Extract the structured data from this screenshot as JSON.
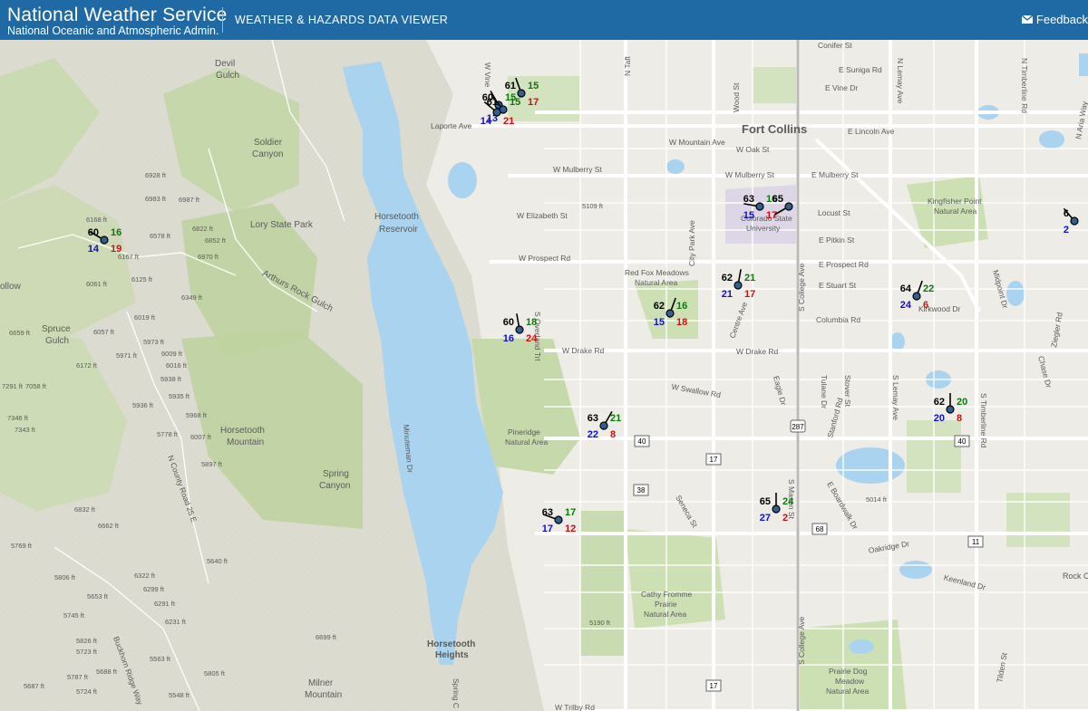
{
  "header": {
    "brand_title": "National Weather Service",
    "brand_subtitle": "National Oceanic and Atmospheric Admin.",
    "viewer_title": "WEATHER & HAZARDS DATA VIEWER",
    "feedback_label": "Feedback",
    "feedback_icon": "mail-icon"
  },
  "colors": {
    "header_bg": "#1f6aa5",
    "water": "#a9d3ee",
    "park_green": "#c8dcb3",
    "temperature": "#000000",
    "dewpoint": "#0a7a0a",
    "wind_speed": "#1010c8",
    "wind_gust": "#d01010",
    "station_marker": "#2f5f8f"
  },
  "map": {
    "place_labels": {
      "fort_collins": "Fort Collins",
      "horsetooth_reservoir": "Horsetooth Reservoir",
      "horsetooth_mountain": "Horsetooth Mountain",
      "horsetooth_heights": "Horsetooth Heights",
      "lory_state_park": "Lory State Park",
      "soldier_canyon": "Soldier Canyon",
      "devil_gulch": "Devil Gulch",
      "spruce_gulch": "Spruce Gulch",
      "spring_canyon": "Spring Canyon",
      "milner_mountain": "Milner Mountain",
      "arthurs_rock_gulch": "Arthurs Rock Gulch",
      "pineridge_natural_area": "Pineridge Natural Area",
      "red_fox_meadows": "Red Fox Meadows Natural Area",
      "colorado_state_university": "Colorado State University",
      "kingfisher_point": "Kingfisher Point Natural Area",
      "cathy_fromme": "Cathy Fromme Prairie Natural Area",
      "prairie_dog_meadow": "Prairie Dog Meadow Natural Area",
      "hollow_partial": "ollow",
      "rock_partial": "Rock C"
    },
    "street_labels": {
      "laporte_ave": "Laporte Ave",
      "w_mountain_ave": "W Mountain Ave",
      "w_oak_st": "W Oak St",
      "w_mulberry_st": "W Mulberry St",
      "w_mulberry_st_2": "W Mulberry St",
      "e_mulberry_st": "E Mulberry St",
      "w_elizabeth_st": "W Elizabeth St",
      "locust_st": "Locust St",
      "e_pitkin_st": "E Pitkin St",
      "w_prospect_rd": "W Prospect Rd",
      "e_prospect_rd": "E Prospect Rd",
      "e_stuart_st": "E Stuart St",
      "columbia_rd": "Columbia Rd",
      "kirkwood_dr": "Kirkwood Dr",
      "w_drake_rd": "W Drake Rd",
      "w_drake_rd_2": "W Drake Rd",
      "e_drake_rd": "E Drake Rd",
      "swallow_rd": "W Swallow Rd",
      "w_trilby_rd": "W Trilby Rd",
      "e_suniga_rd": "E Suniga Rd",
      "e_vine_dr": "E Vine Dr",
      "e_lincoln_ave": "E Lincoln Ave",
      "conifer_st": "Conifer St",
      "keenland_dr": "Keenland Dr",
      "oakridge_dr": "Oakridge Dr",
      "s_college_ave": "S College Ave",
      "s_college_ave_2": "S College Ave",
      "s_timberline_rd": "S Timberline Rd",
      "n_timberline_rd": "N Timberline Rd",
      "s_lemay_ave": "S Lemay Ave",
      "n_lemay_ave": "N Lemay Ave",
      "city_park_ave": "City Park Ave",
      "centre_ave": "Centre Ave",
      "wood_st": "Wood St",
      "n_taft": "N Taft",
      "w_vine": "W Vine",
      "s_overland_trl": "S Overland Trl",
      "minuteman_dr": "Minuteman Dr",
      "n_county_road_25e": "N County Road 25 E",
      "buckhorn_ridge_way": "Buckhorn Ridge Way",
      "spring_c": "Spring C",
      "stanford_rd": "Stanford Rd",
      "tulane_dr": "Tulane Dr",
      "stover_st": "Stover St",
      "s_mason_st": "S Mason St",
      "eagle_dr": "Eagle Dr",
      "seneca_st": "Seneca St",
      "e_boardwalk_dr": "E Boardwalk Dr",
      "midpoint_dr": "Midpoint Dr",
      "chase_dr": "Chase Dr",
      "ziegler_rd": "Ziegler Rd",
      "tilden_st": "Tilden St",
      "n_aria_way": "N Aria Way"
    },
    "road_shields": [
      "287",
      "40",
      "40",
      "17",
      "38",
      "68",
      "11",
      "17"
    ],
    "elevations": [
      "6928 ft",
      "6983 ft",
      "6987 ft",
      "6168 ft",
      "6578 ft",
      "6822 ft",
      "6852 ft",
      "6970 ft",
      "6167 ft",
      "6061 ft",
      "6125 ft",
      "6349 ft",
      "6019 ft",
      "6057 ft",
      "5973 ft",
      "5971 ft",
      "6009 ft",
      "6016 ft",
      "6172 ft",
      "5938 ft",
      "6659 ft",
      "7291 ft",
      "7058 ft",
      "5935 ft",
      "5936 ft",
      "5968 ft",
      "7346 ft",
      "7343 ft",
      "5778 ft",
      "6007 ft",
      "5897 ft",
      "6832 ft",
      "6662 ft",
      "5769 ft",
      "5640 ft",
      "5806 ft",
      "6322 ft",
      "5653 ft",
      "6299 ft",
      "5745 ft",
      "6291 ft",
      "6231 ft",
      "5826 ft",
      "5723 ft",
      "5563 ft",
      "5787 ft",
      "5688 ft",
      "5805 ft",
      "5724 ft",
      "5687 ft",
      "5548 ft",
      "5109 ft",
      "5014 ft",
      "5190 ft",
      "6699 ft"
    ],
    "stations": [
      {
        "temp": "61",
        "dew": "15",
        "wind": "",
        "gust": "17"
      },
      {
        "temp": "60",
        "dew": "15",
        "wind": "",
        "gust": ""
      },
      {
        "temp": "61",
        "dew": "15",
        "wind": "13",
        "gust": ""
      },
      {
        "temp": "",
        "dew": "",
        "wind": "14",
        "gust": "21"
      },
      {
        "temp": "60",
        "dew": "16",
        "wind": "14",
        "gust": "19"
      },
      {
        "temp": "63",
        "dew": "16",
        "wind": "15",
        "gust": "17"
      },
      {
        "temp": "65",
        "dew": "",
        "wind": "",
        "gust": ""
      },
      {
        "temp": "62",
        "dew": "21",
        "wind": "21",
        "gust": "17"
      },
      {
        "temp": "62",
        "dew": "16",
        "wind": "15",
        "gust": "18"
      },
      {
        "temp": "60",
        "dew": "18",
        "wind": "16",
        "gust": "24"
      },
      {
        "temp": "64",
        "dew": "22",
        "wind": "24",
        "gust": "6"
      },
      {
        "temp": "62",
        "dew": "20",
        "wind": "20",
        "gust": "8"
      },
      {
        "temp": "63",
        "dew": "21",
        "wind": "22",
        "gust": "8"
      },
      {
        "temp": "65",
        "dew": "24",
        "wind": "27",
        "gust": "2"
      },
      {
        "temp": "63",
        "dew": "17",
        "wind": "17",
        "gust": "12"
      },
      {
        "temp": "6",
        "dew": "",
        "wind": "2",
        "gust": ""
      }
    ]
  }
}
